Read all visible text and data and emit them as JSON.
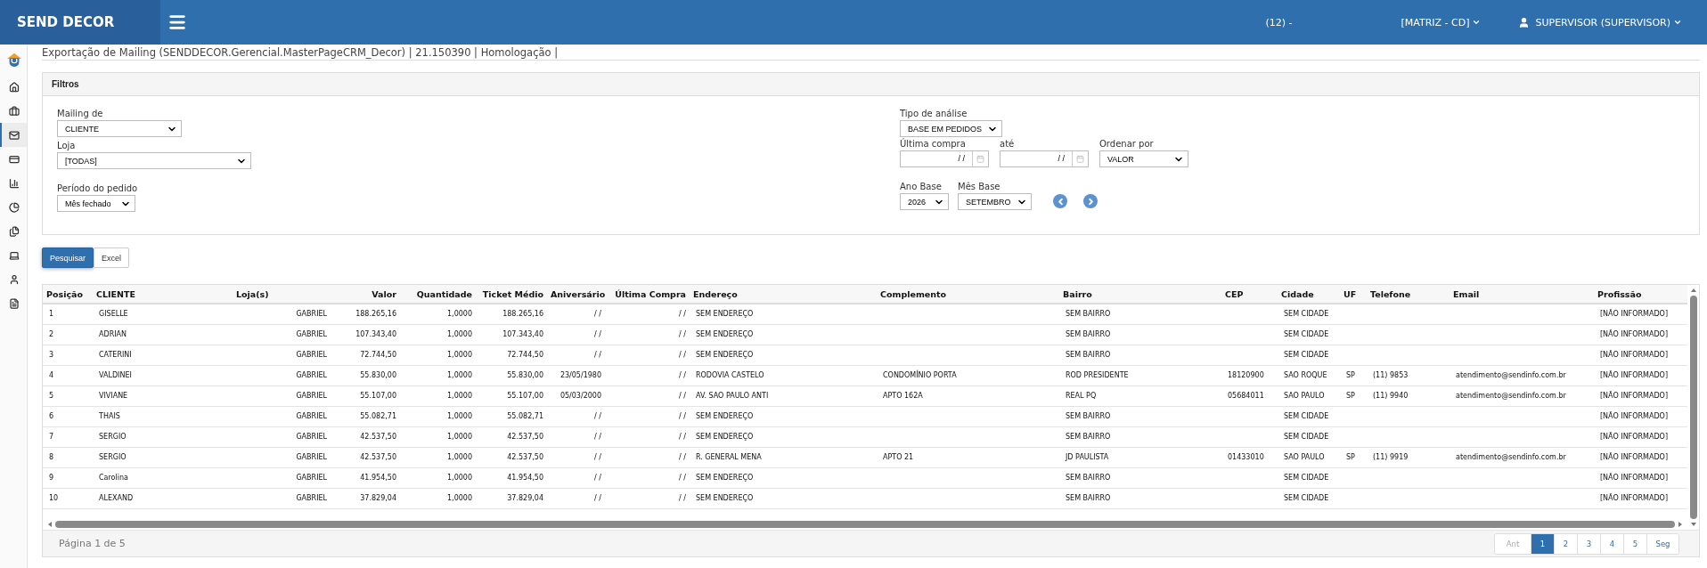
{
  "topbar": {
    "brand": "SEND DECOR",
    "company": "(12) -",
    "branch": "[MATRIZ - CD]",
    "user": "SUPERVISOR (SUPERVISOR)"
  },
  "sidebar_items": [
    {
      "kind": "logo",
      "selected": false
    },
    {
      "kind": "home",
      "selected": false
    },
    {
      "kind": "briefcase",
      "selected": false
    },
    {
      "kind": "mail",
      "selected": true
    },
    {
      "kind": "card",
      "selected": false
    },
    {
      "kind": "bars",
      "selected": false
    },
    {
      "kind": "pie",
      "selected": false
    },
    {
      "kind": "files",
      "selected": false
    },
    {
      "kind": "laptop",
      "selected": false
    },
    {
      "kind": "user",
      "selected": false
    },
    {
      "kind": "document",
      "selected": false
    }
  ],
  "page_title": "Exportação de Mailing (SENDDECOR.Gerencial.MasterPageCRM_Decor) | 21.150390 | Homologação |",
  "filters": {
    "title": "Filtros",
    "mailing_de": {
      "label": "Mailing de",
      "value": "CLIENTE"
    },
    "loja": {
      "label": "Loja",
      "value": "[TODAS]"
    },
    "periodo": {
      "label": "Período do pedido",
      "value": "Mês fechado"
    },
    "tipo_analise": {
      "label": "Tipo de análise",
      "value": "BASE EM PEDIDOS"
    },
    "ultima_compra": {
      "label": "Última compra",
      "value": "/ /"
    },
    "ate": {
      "label": "até",
      "value": "/ /"
    },
    "ordenar_por": {
      "label": "Ordenar por",
      "value": "VALOR"
    },
    "ano_base": {
      "label": "Ano Base",
      "value": "2026"
    },
    "mes_base": {
      "label": "Mês Base",
      "value": "SETEMBRO"
    }
  },
  "buttons": [
    {
      "label": "Pesquisar",
      "primary": true
    },
    {
      "label": "Excel",
      "primary": false
    }
  ],
  "table": {
    "columns": [
      "Posição",
      "CLIENTE",
      "Loja(s)",
      "Valor",
      "Quantidade",
      "Ticket Médio",
      "Aniversário",
      "Última Compra",
      "Endereço",
      "Complemento",
      "Bairro",
      "CEP",
      "Cidade",
      "UF",
      "Telefone",
      "Email",
      "Profissão"
    ],
    "rows": [
      [
        "1",
        "GISELLE",
        "GABRIEL",
        "188.265,16",
        "1,0000",
        "188.265,16",
        "/ /",
        "/ /",
        "SEM ENDEREÇO",
        null,
        "SEM BAIRRO",
        null,
        "SEM CIDADE",
        null,
        null,
        null,
        "[NÃO INFORMADO]"
      ],
      [
        "2",
        "ADRIAN",
        "GABRIEL",
        "107.343,40",
        "1,0000",
        "107.343,40",
        "/ /",
        "/ /",
        "SEM ENDEREÇO",
        null,
        "SEM BAIRRO",
        null,
        "SEM CIDADE",
        null,
        null,
        null,
        "[NÃO INFORMADO]"
      ],
      [
        "3",
        "CATERINI",
        "GABRIEL",
        "72.744,50",
        "1,0000",
        "72.744,50",
        "/ /",
        "/ /",
        "SEM ENDEREÇO",
        null,
        "SEM BAIRRO",
        null,
        "SEM CIDADE",
        null,
        null,
        null,
        "[NÃO INFORMADO]"
      ],
      [
        "4",
        "VALDINEI",
        "GABRIEL",
        "55.830,00",
        "1,0000",
        "55.830,00",
        "23/05/1980",
        "/ /",
        "RODOVIA CASTELO",
        "CONDOMÍNIO PORTA",
        "ROD PRESIDENTE",
        "18120900",
        "SAO ROQUE",
        "SP",
        "(11) 9853",
        "atendimento@sendinfo.com.br",
        "[NÃO INFORMADO]"
      ],
      [
        "5",
        "VIVIANE",
        "GABRIEL",
        "55.107,00",
        "1,0000",
        "55.107,00",
        "05/03/2000",
        "/ /",
        "AV. SAO PAULO ANTI",
        "APTO 162A",
        "REAL PQ",
        "05684011",
        "SAO PAULO",
        "SP",
        "(11) 9940",
        "atendimento@sendinfo.com.br",
        "[NÃO INFORMADO]"
      ],
      [
        "6",
        "THAIS",
        "GABRIEL",
        "55.082,71",
        "1,0000",
        "55.082,71",
        "/ /",
        "/ /",
        "SEM ENDEREÇO",
        null,
        "SEM BAIRRO",
        null,
        "SEM CIDADE",
        null,
        null,
        null,
        "[NÃO INFORMADO]"
      ],
      [
        "7",
        "SERGIO",
        "GABRIEL",
        "42.537,50",
        "1,0000",
        "42.537,50",
        "/ /",
        "/ /",
        "SEM ENDEREÇO",
        null,
        "SEM BAIRRO",
        null,
        "SEM CIDADE",
        null,
        null,
        null,
        "[NÃO INFORMADO]"
      ],
      [
        "8",
        "SERGIO",
        "GABRIEL",
        "42.537,50",
        "1,0000",
        "42.537,50",
        "/ /",
        "/ /",
        "R. GENERAL MENA",
        "APTO 21",
        "JD PAULISTA",
        "01433010",
        "SAO PAULO",
        "SP",
        "(11) 9919",
        "atendimento@sendinfo.com.br",
        "[NÃO INFORMADO]"
      ],
      [
        "9",
        "Carolina",
        "GABRIEL",
        "41.954,50",
        "1,0000",
        "41.954,50",
        "/ /",
        "/ /",
        "SEM ENDEREÇO",
        null,
        "SEM BAIRRO",
        null,
        "SEM CIDADE",
        null,
        null,
        null,
        "[NÃO INFORMADO]"
      ],
      [
        "10",
        "ALEXAND",
        "GABRIEL",
        "37.829,04",
        "1,0000",
        "37.829,04",
        "/ /",
        "/ /",
        "SEM ENDEREÇO",
        null,
        "SEM BAIRRO",
        null,
        "SEM CIDADE",
        null,
        null,
        null,
        "[NÃO INFORMADO]"
      ]
    ]
  },
  "pagination": {
    "summary": "Página 1 de 5",
    "prev": {
      "label": "Ant",
      "disabled": true
    },
    "pages": [
      {
        "label": "1",
        "selected": true
      },
      {
        "label": "2",
        "selected": false
      },
      {
        "label": "3",
        "selected": false
      },
      {
        "label": "4",
        "selected": false
      },
      {
        "label": "5",
        "selected": false
      }
    ],
    "next": {
      "label": "Seg",
      "disabled": false
    }
  }
}
